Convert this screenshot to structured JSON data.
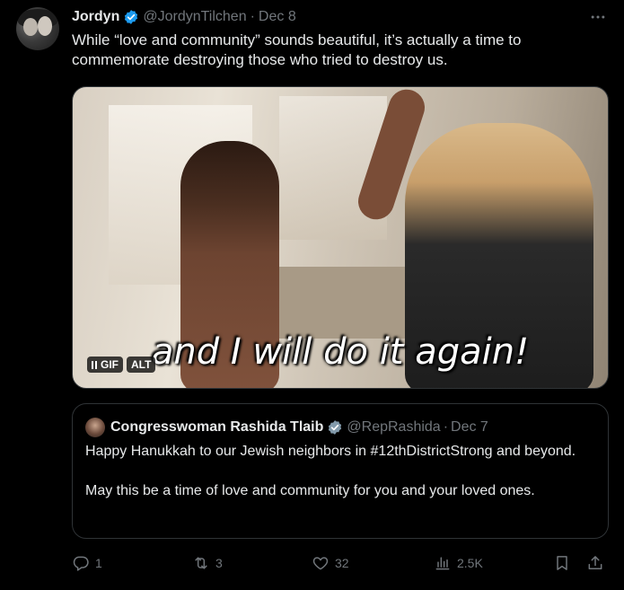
{
  "colors": {
    "background": "#000000",
    "text": "#e7e9ea",
    "muted": "#71767b",
    "verified": "#1d9bf0",
    "border": "#2f3336"
  },
  "tweet": {
    "author_name": "Jordyn",
    "author_handle": "@JordynTilchen",
    "separator": "·",
    "date": "Dec 8",
    "more_icon": "more-horizontal-icon",
    "text": "While “love and community” sounds beautiful, it’s actually a time to commemorate destroying those who tried to destroy us."
  },
  "media": {
    "caption": "and I will do it again!",
    "gif_badge": "GIF",
    "alt_badge": "ALT",
    "pause_icon": "pause-icon"
  },
  "quote": {
    "author_name": "Congresswoman Rashida Tlaib",
    "author_handle": "@RepRashida",
    "separator": "·",
    "date": "Dec 7",
    "paragraph1": "Happy Hanukkah to our Jewish neighbors in #12thDistrictStrong and beyond.",
    "paragraph2": "May this be a time of love and community for you and your loved ones."
  },
  "actions": {
    "replies": "1",
    "reposts": "3",
    "likes": "32",
    "views": "2.5K",
    "icons": [
      "reply-icon",
      "repost-icon",
      "like-icon",
      "views-icon",
      "bookmark-icon",
      "share-icon"
    ]
  }
}
